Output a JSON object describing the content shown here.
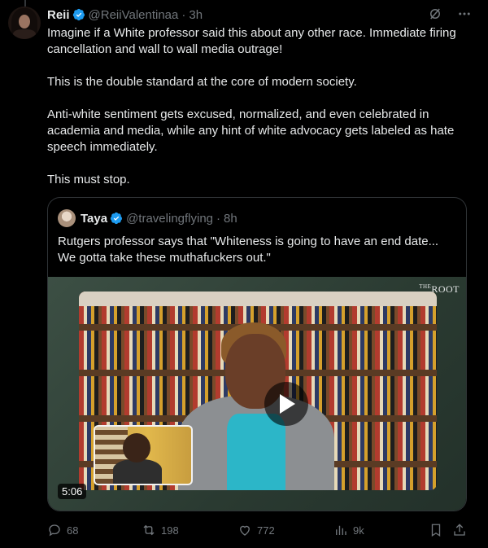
{
  "tweet": {
    "author_name": "Reii",
    "handle": "@ReiiValentinaa",
    "separator": "·",
    "time": "3h",
    "paragraphs": [
      "Imagine if a White professor said this about any other race. Immediate firing cancellation and wall to wall media outrage!",
      "This is the double standard at the core of modern society.",
      "Anti-white sentiment gets excused, normalized, and even celebrated in academia and media, while any hint of white advocacy gets labeled as hate speech immediately.",
      "This must stop."
    ],
    "header_icons": [
      "grok-icon",
      "more-icon"
    ]
  },
  "quote": {
    "author_name": "Taya",
    "handle": "@travelingflying",
    "separator": "·",
    "time": "8h",
    "text": "Rutgers professor says that \"Whiteness is going to have an end date... We gotta take these muthafuckers out.\"",
    "media": {
      "logo_prefix": "THE",
      "logo_main": "ROOT",
      "duration": "5:06"
    }
  },
  "actions": {
    "replies": "68",
    "reposts": "198",
    "likes": "772",
    "views": "9k"
  },
  "colors": {
    "verified": "#1d9bf0",
    "muted": "#71767b",
    "text": "#e7e9ea",
    "border": "#2f3336"
  }
}
